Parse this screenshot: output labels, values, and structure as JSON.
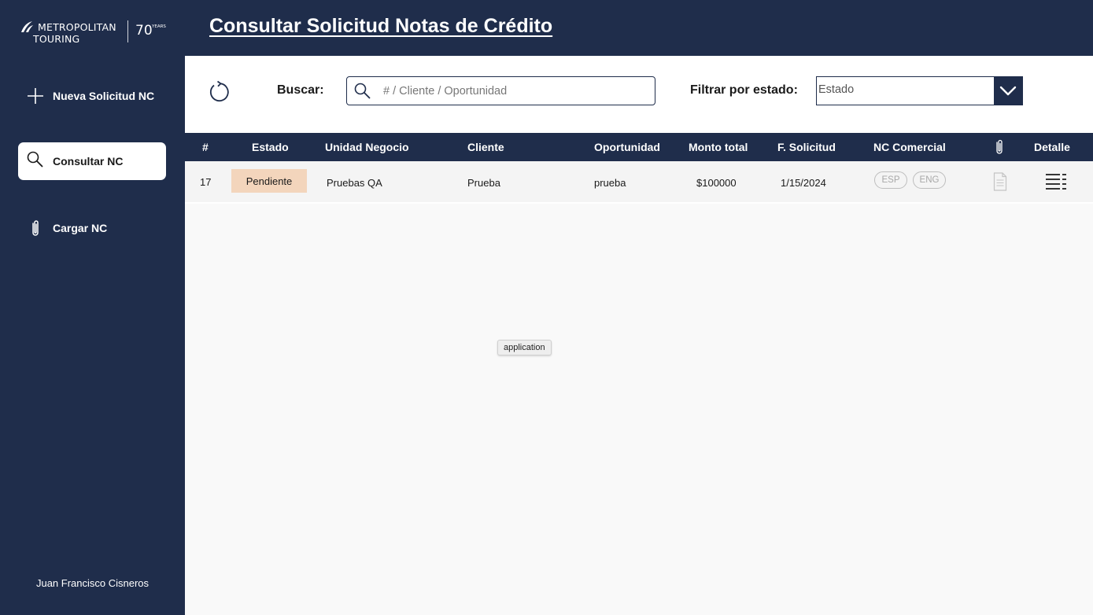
{
  "brand": {
    "name_line1": "METROPOLITAN",
    "name_line2": "TOURING",
    "anniversary_number": "70",
    "anniversary_word": "YEARS",
    "color_primary": "#1f2d4b"
  },
  "sidebar": {
    "items": [
      {
        "label": "Nueva Solicitud NC",
        "icon": "plus-icon",
        "active": false
      },
      {
        "label": "Consultar NC",
        "icon": "search-icon",
        "active": true
      },
      {
        "label": "Cargar NC",
        "icon": "paperclip-icon",
        "active": false
      }
    ],
    "user_name": "Juan Francisco Cisneros"
  },
  "header": {
    "title": "Consultar Solicitud Notas de Crédito"
  },
  "toolbar": {
    "refresh_icon": "refresh-icon",
    "search_label": "Buscar:",
    "search_placeholder": "# / Cliente / Oportunidad",
    "search_value": "",
    "filter_label": "Filtrar por estado:",
    "filter_value": "Estado"
  },
  "table": {
    "columns": [
      "#",
      "Estado",
      "Unidad Negocio",
      "Cliente",
      "Oportunidad",
      "Monto total",
      "F. Solicitud",
      "NC Comercial",
      "",
      "Detalle"
    ],
    "attachment_column_icon": "paperclip-icon",
    "rows": [
      {
        "id": "17",
        "estado": "Pendiente",
        "estado_color": "#f3d5bc",
        "unidad_negocio": "Pruebas QA",
        "cliente": "Prueba",
        "oportunidad": "prueba",
        "monto_total": "$100000",
        "fecha_solicitud": "1/15/2024",
        "nc_comercial": [
          "ESP",
          "ENG"
        ],
        "attachment_icon": "document-icon",
        "detail_icon": "list-detail-icon"
      }
    ]
  },
  "tooltip": {
    "text": "application"
  }
}
